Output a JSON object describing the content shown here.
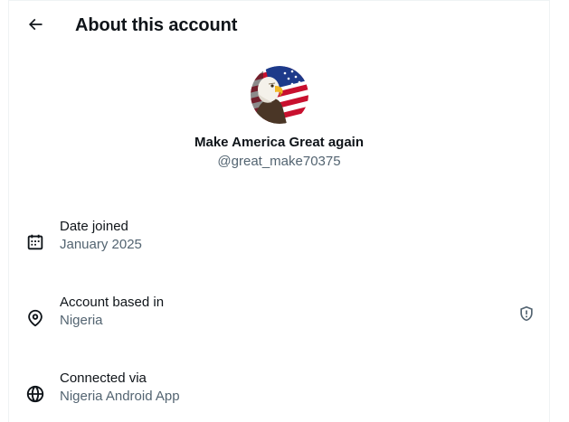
{
  "header": {
    "title": "About this account",
    "back_icon": "arrow-left-icon"
  },
  "profile": {
    "display_name": "Make America Great again",
    "handle": "@great_make70375",
    "avatar": "bald-eagle-american-flag-avatar"
  },
  "info_rows": [
    {
      "icon": "calendar-icon",
      "label": "Date joined",
      "value": "January 2025"
    },
    {
      "icon": "location-pin-icon",
      "label": "Account based in",
      "value": "Nigeria",
      "badge_icon": "shield-alert-icon"
    },
    {
      "icon": "globe-icon",
      "label": "Connected via",
      "value": "Nigeria Android App"
    }
  ],
  "colors": {
    "text_primary": "#0f1419",
    "text_secondary": "#536471",
    "border": "#eff3f4"
  }
}
